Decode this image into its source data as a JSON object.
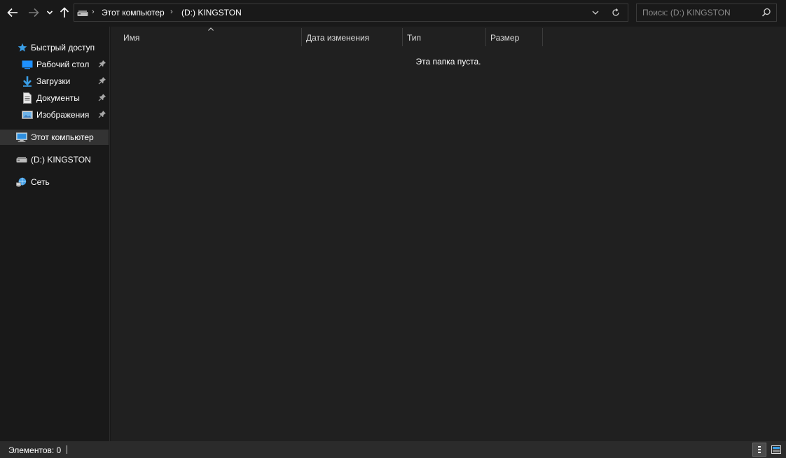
{
  "navigation": {
    "back_icon": "arrow-left-icon",
    "forward_icon": "arrow-right-icon",
    "recent_icon": "chevron-down-icon",
    "up_icon": "arrow-up-icon"
  },
  "address": {
    "breadcrumbs": [
      "Этот компьютер",
      "(D:) KINGSTON"
    ],
    "separator": "›"
  },
  "search": {
    "placeholder": "Поиск: (D:) KINGSTON"
  },
  "sidebar": {
    "quick_access": "Быстрый доступ",
    "items": [
      {
        "label": "Рабочий стол",
        "icon": "desktop-icon",
        "pinned": true
      },
      {
        "label": "Загрузки",
        "icon": "download-icon",
        "pinned": true
      },
      {
        "label": "Документы",
        "icon": "document-icon",
        "pinned": true
      },
      {
        "label": "Изображения",
        "icon": "pictures-icon",
        "pinned": true
      }
    ],
    "this_pc": "Этот компьютер",
    "drive": "(D:) KINGSTON",
    "network": "Сеть"
  },
  "columns": {
    "name": "Имя",
    "date": "Дата изменения",
    "type": "Тип",
    "size": "Размер"
  },
  "content": {
    "empty_message": "Эта папка пуста."
  },
  "status": {
    "items_count": "Элементов: 0"
  },
  "colors": {
    "background": "#191919",
    "content_bg": "#202020",
    "status_bg": "#2b2b2b",
    "accent_blue": "#3a9ee6",
    "selected_bg": "#333333"
  }
}
